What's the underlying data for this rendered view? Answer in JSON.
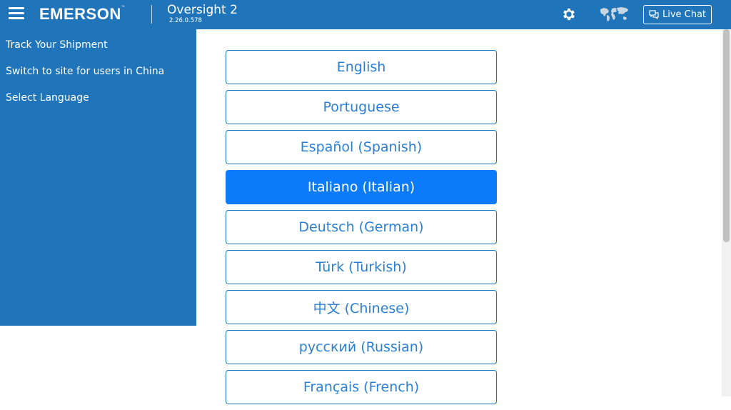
{
  "header": {
    "brand": "EMERSON",
    "brand_mark": "™",
    "app_title": "Oversight 2",
    "app_version": "2.26.0.578",
    "live_chat_label": "Live Chat",
    "icons": [
      "hamburger-menu-icon",
      "gear-icon",
      "world-map-icon",
      "chat-bubbles-icon"
    ]
  },
  "sidebar": {
    "items": [
      {
        "label": "Track Your Shipment"
      },
      {
        "label": "Switch to site for users in China"
      },
      {
        "label": "Select Language"
      }
    ]
  },
  "languages": {
    "selected": "Italiano (Italian)",
    "items": [
      {
        "label": "English"
      },
      {
        "label": "Portuguese"
      },
      {
        "label": "Español (Spanish)"
      },
      {
        "label": "Italiano (Italian)"
      },
      {
        "label": "Deutsch (German)"
      },
      {
        "label": "Türk (Turkish)"
      },
      {
        "label": "中文 (Chinese)"
      },
      {
        "label": "русский (Russian)"
      },
      {
        "label": "Français (French)"
      }
    ]
  },
  "colors": {
    "header_bg": "#1f74ba",
    "sidebar_bg": "#1f74ba",
    "button_text": "#2a7fd4",
    "button_border": "#1f74ba",
    "selected_bg": "#0b7bfb"
  }
}
